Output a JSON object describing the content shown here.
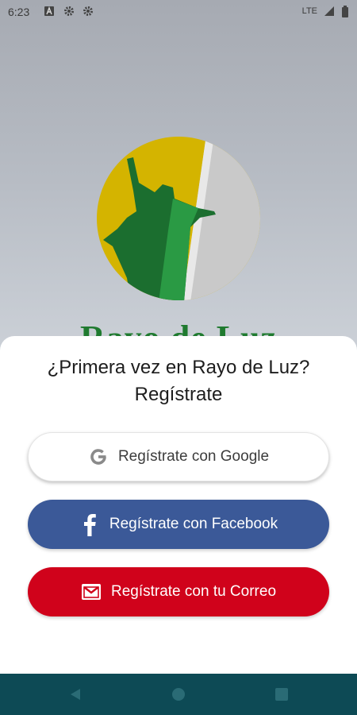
{
  "status_bar": {
    "time": "6:23",
    "network": "LTE",
    "icons": [
      "a-box-icon",
      "gear-icon",
      "gear-icon",
      "signal-icon",
      "battery-icon"
    ]
  },
  "brand": {
    "name_peek": "Rayo de Luz",
    "logo_colors": {
      "gold": "#d4b400",
      "green": "#1f8a3a",
      "silver": "#c9c9c9"
    }
  },
  "sheet": {
    "title_line1": "¿Primera vez en Rayo de Luz?",
    "title_line2": "Regístrate"
  },
  "buttons": {
    "google": {
      "label": "Regístrate con Google",
      "icon": "google-icon"
    },
    "facebook": {
      "label": "Regístrate con Facebook",
      "icon": "facebook-icon",
      "color": "#3b5998"
    },
    "email": {
      "label": "Regístrate con tu Correo",
      "icon": "mail-icon",
      "color": "#d0021b"
    }
  },
  "nav_bar": {
    "icons": [
      "back-icon",
      "home-icon",
      "recents-icon"
    ],
    "color": "#0d4a55"
  }
}
